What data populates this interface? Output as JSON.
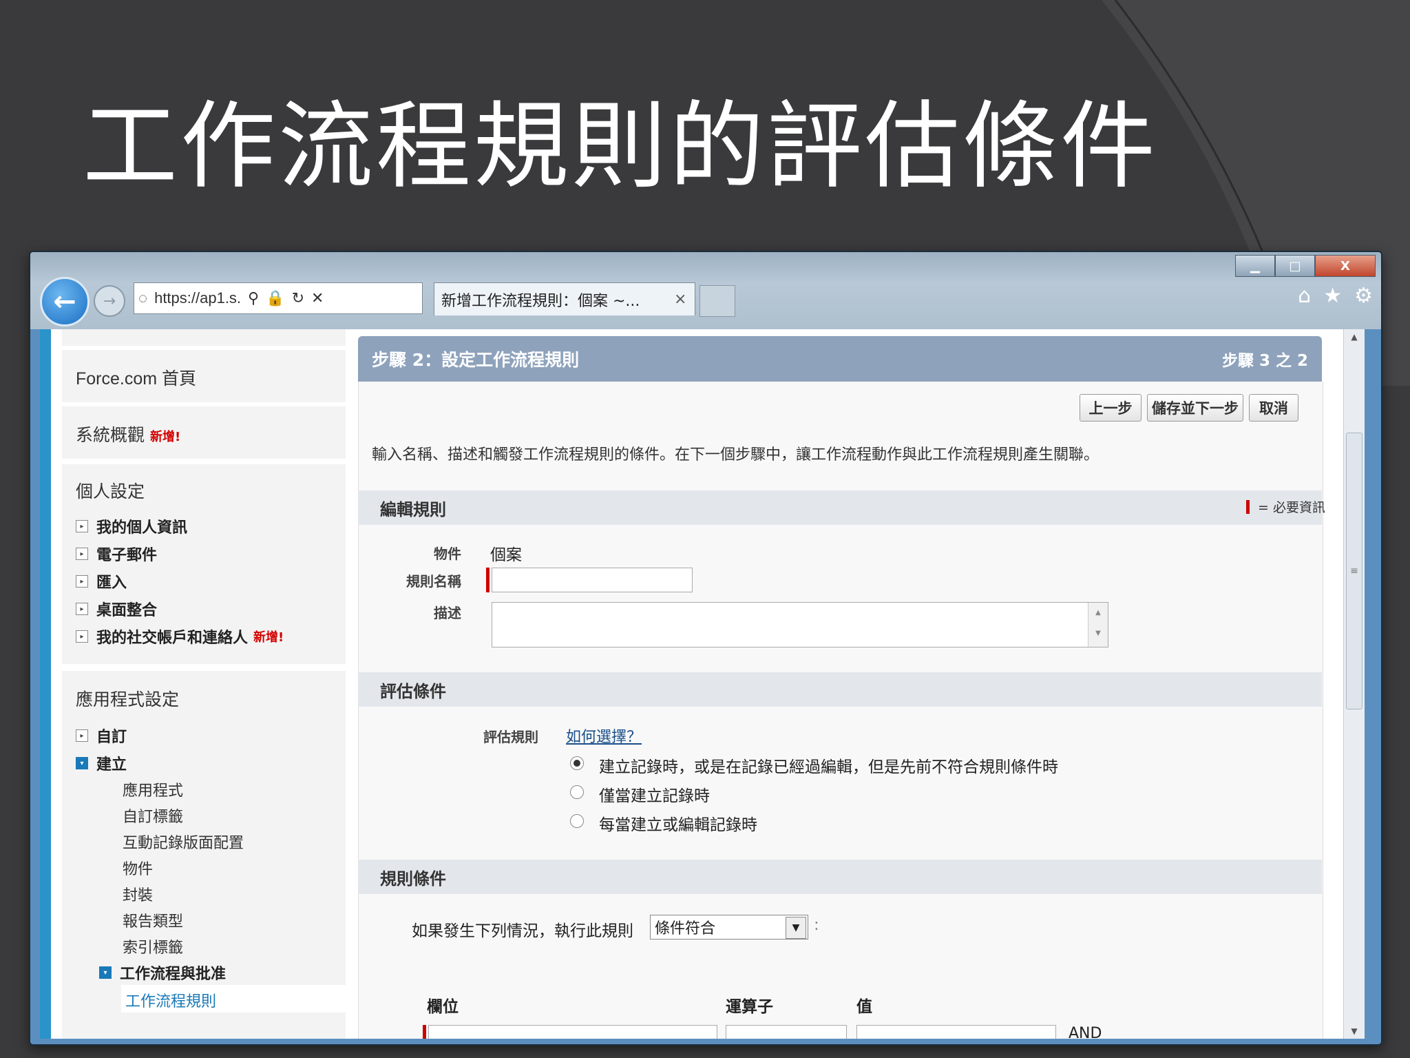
{
  "slide": {
    "title": "工作流程規則的評估條件"
  },
  "browser": {
    "address": "https://ap1.s.",
    "tab_title": "新增工作流程規則：個案 ~...",
    "tab_close": "×",
    "win_min": "▁",
    "win_max": "□",
    "win_close": "X"
  },
  "sidebar": {
    "home": "Force.com 首頁",
    "overview": "系統概觀",
    "overview_badge": "新增!",
    "personal_header": "個人設定",
    "personal_items": [
      "我的個人資訊",
      "電子郵件",
      "匯入",
      "桌面整合",
      "我的社交帳戶和連絡人"
    ],
    "social_badge": "新增!",
    "app_header": "應用程式設定",
    "app_items": [
      "自訂",
      "建立"
    ],
    "create_sub": [
      "應用程式",
      "自訂標籤",
      "互動記錄版面配置",
      "物件",
      "封裝",
      "報告類型",
      "索引標籤"
    ],
    "workflow_item": "工作流程與批准",
    "workflow_sub": "工作流程規則"
  },
  "main": {
    "step_title": "步驟 2：設定工作流程規則",
    "step_count": "步驟 3 之 2",
    "buttons": {
      "prev": "上一步",
      "save_next": "儲存並下一步",
      "cancel": "取消"
    },
    "intro": "輸入名稱、描述和觸發工作流程規則的條件。在下一個步驟中，讓工作流程動作與此工作流程規則產生關聯。",
    "edit_section": "編輯規則",
    "required_note": "= 必要資訊",
    "object_label": "物件",
    "object_value": "個案",
    "rule_name_label": "規則名稱",
    "rule_name_value": "",
    "desc_label": "描述",
    "desc_value": "",
    "eval_section": "評估條件",
    "eval_rule_label": "評估規則",
    "how_choose_link": "如何選擇？",
    "eval_options": [
      "建立記錄時，或是在記錄已經過編輯，但是先前不符合規則條件時",
      "僅當建立記錄時",
      "每當建立或編輯記錄時"
    ],
    "eval_selected": 0,
    "criteria_section": "規則條件",
    "run_rule_if": "如果發生下列情況，執行此規則",
    "criteria_select": "條件符合",
    "col_field": "欄位",
    "col_operator": "運算子",
    "col_value": "值",
    "and_text": "AND"
  },
  "colors": {
    "accent": "#2a93c9",
    "step_bar": "#8ea2bc",
    "required": "#cc0000",
    "link": "#1a4f8a"
  }
}
